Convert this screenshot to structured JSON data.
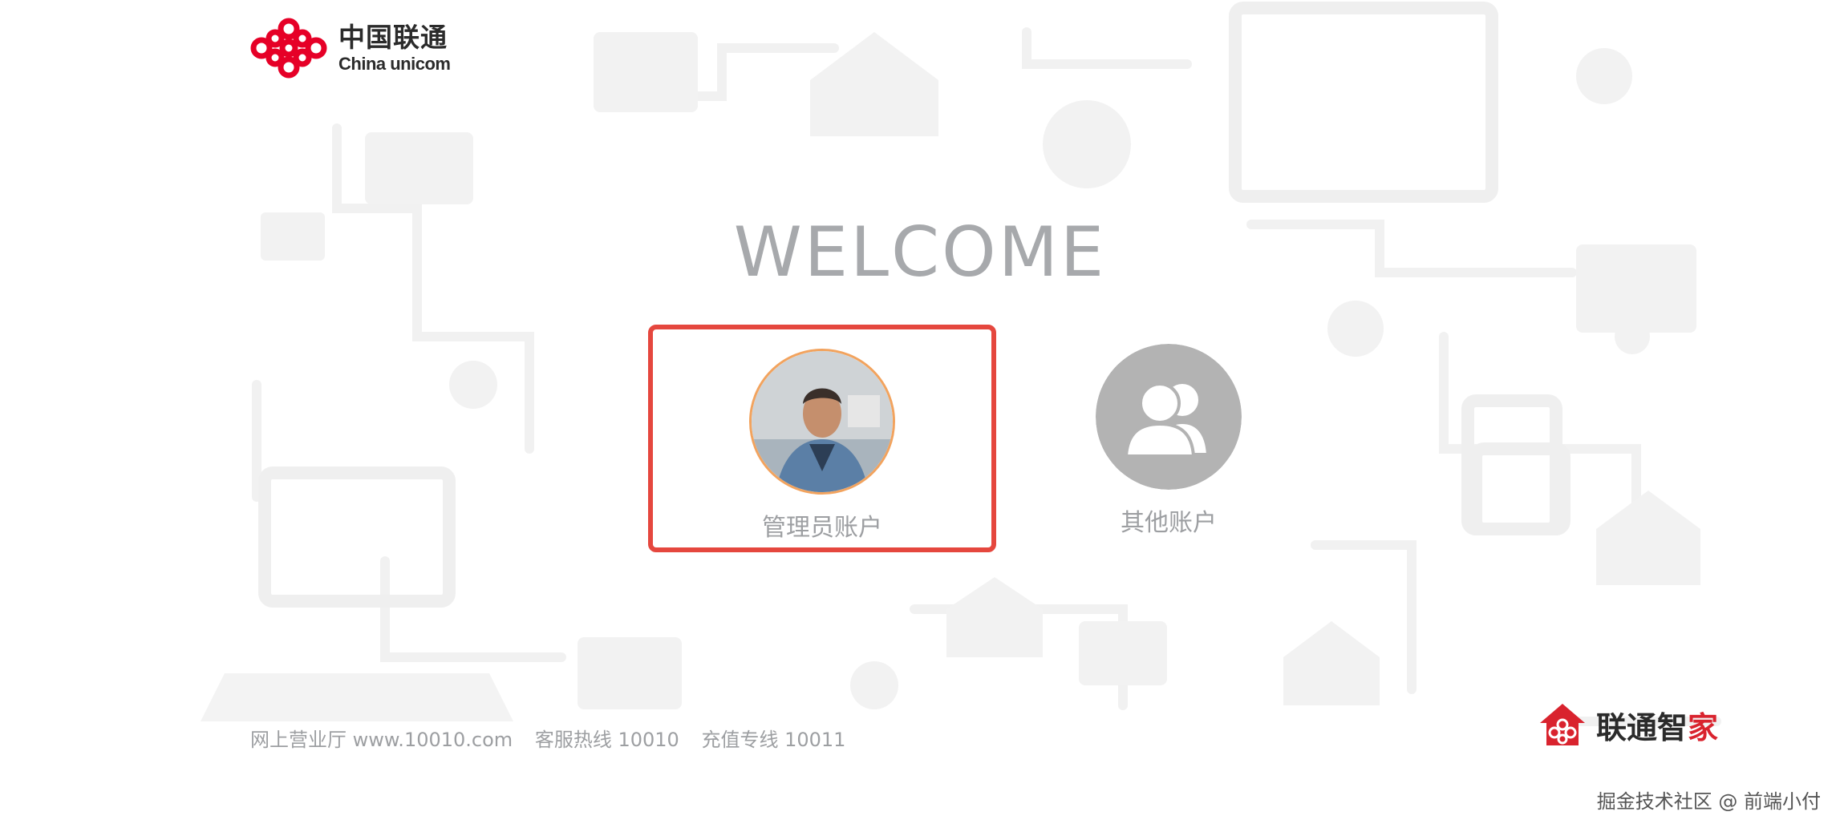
{
  "header": {
    "logo_cn": "中国联通",
    "logo_en": "China unicom"
  },
  "welcome": "WELCOME",
  "accounts": [
    {
      "label": "管理员账户",
      "selected": true,
      "avatar": "admin-photo"
    },
    {
      "label": "其他账户",
      "selected": false,
      "avatar": "users-icon"
    }
  ],
  "footer": {
    "online_hall": "网上营业厅 www.10010.com",
    "service_hotline": "客服热线 10010",
    "recharge_line": "充值专线 10011"
  },
  "brand": {
    "name_main": "联通智",
    "name_accent": "家"
  },
  "watermark": "掘金技术社区 @ 前端小付",
  "colors": {
    "selection_border": "#e5473e",
    "brand_red": "#d9232e",
    "text_gray": "#9d9fa2",
    "welcome_gray": "#a7a9ac",
    "avatar_ring": "#f2a35e"
  }
}
